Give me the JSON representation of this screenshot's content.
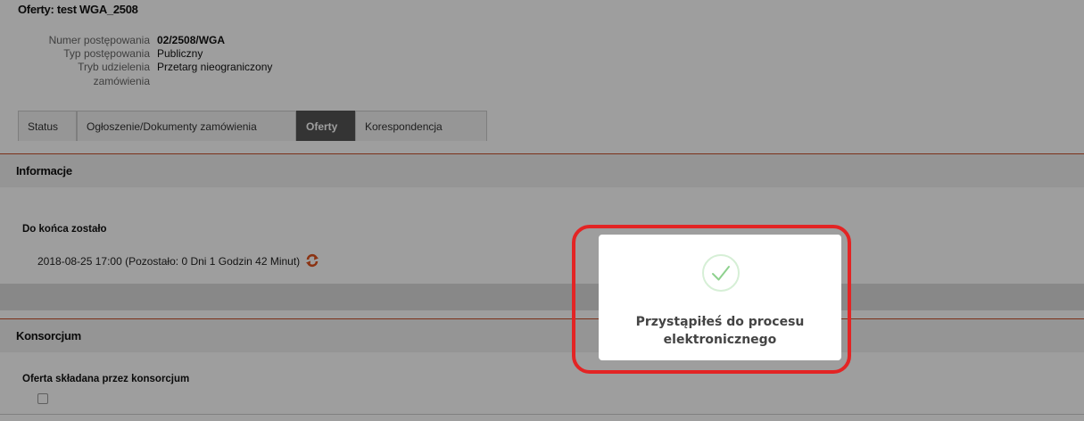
{
  "header": {
    "title": "Oferty: test WGA_2508",
    "meta": [
      {
        "key": "Numer postępowania",
        "value": "02/2508/WGA",
        "bold": true
      },
      {
        "key": "Typ postępowania",
        "value": "Publiczny",
        "bold": false
      },
      {
        "key": "Tryb udzielenia",
        "key2": "zamówienia",
        "value": "Przetarg nieograniczony",
        "bold": false
      }
    ]
  },
  "tabs": [
    {
      "label": "Status",
      "active": false
    },
    {
      "label": "Ogłoszenie/Dokumenty zamówienia",
      "active": false
    },
    {
      "label": "Oferty",
      "active": true
    },
    {
      "label": "Korespondencja",
      "active": false
    }
  ],
  "informacje": {
    "heading": "Informacje",
    "deadline_label": "Do końca zostało",
    "deadline_value": "2018-08-25 17:00 (Pozostało: 0 Dni 1 Godzin 42 Minut)"
  },
  "konsorcjum": {
    "heading": "Konsorcjum",
    "field_label": "Oferta składana przez konsorcjum",
    "checked": false
  },
  "toast": {
    "message_line1": "Przystąpiłeś do procesu",
    "message_line2": "elektronicznego",
    "icon": "checkmark-icon",
    "accent": "#8ed18e",
    "highlight_color": "#e32424"
  }
}
